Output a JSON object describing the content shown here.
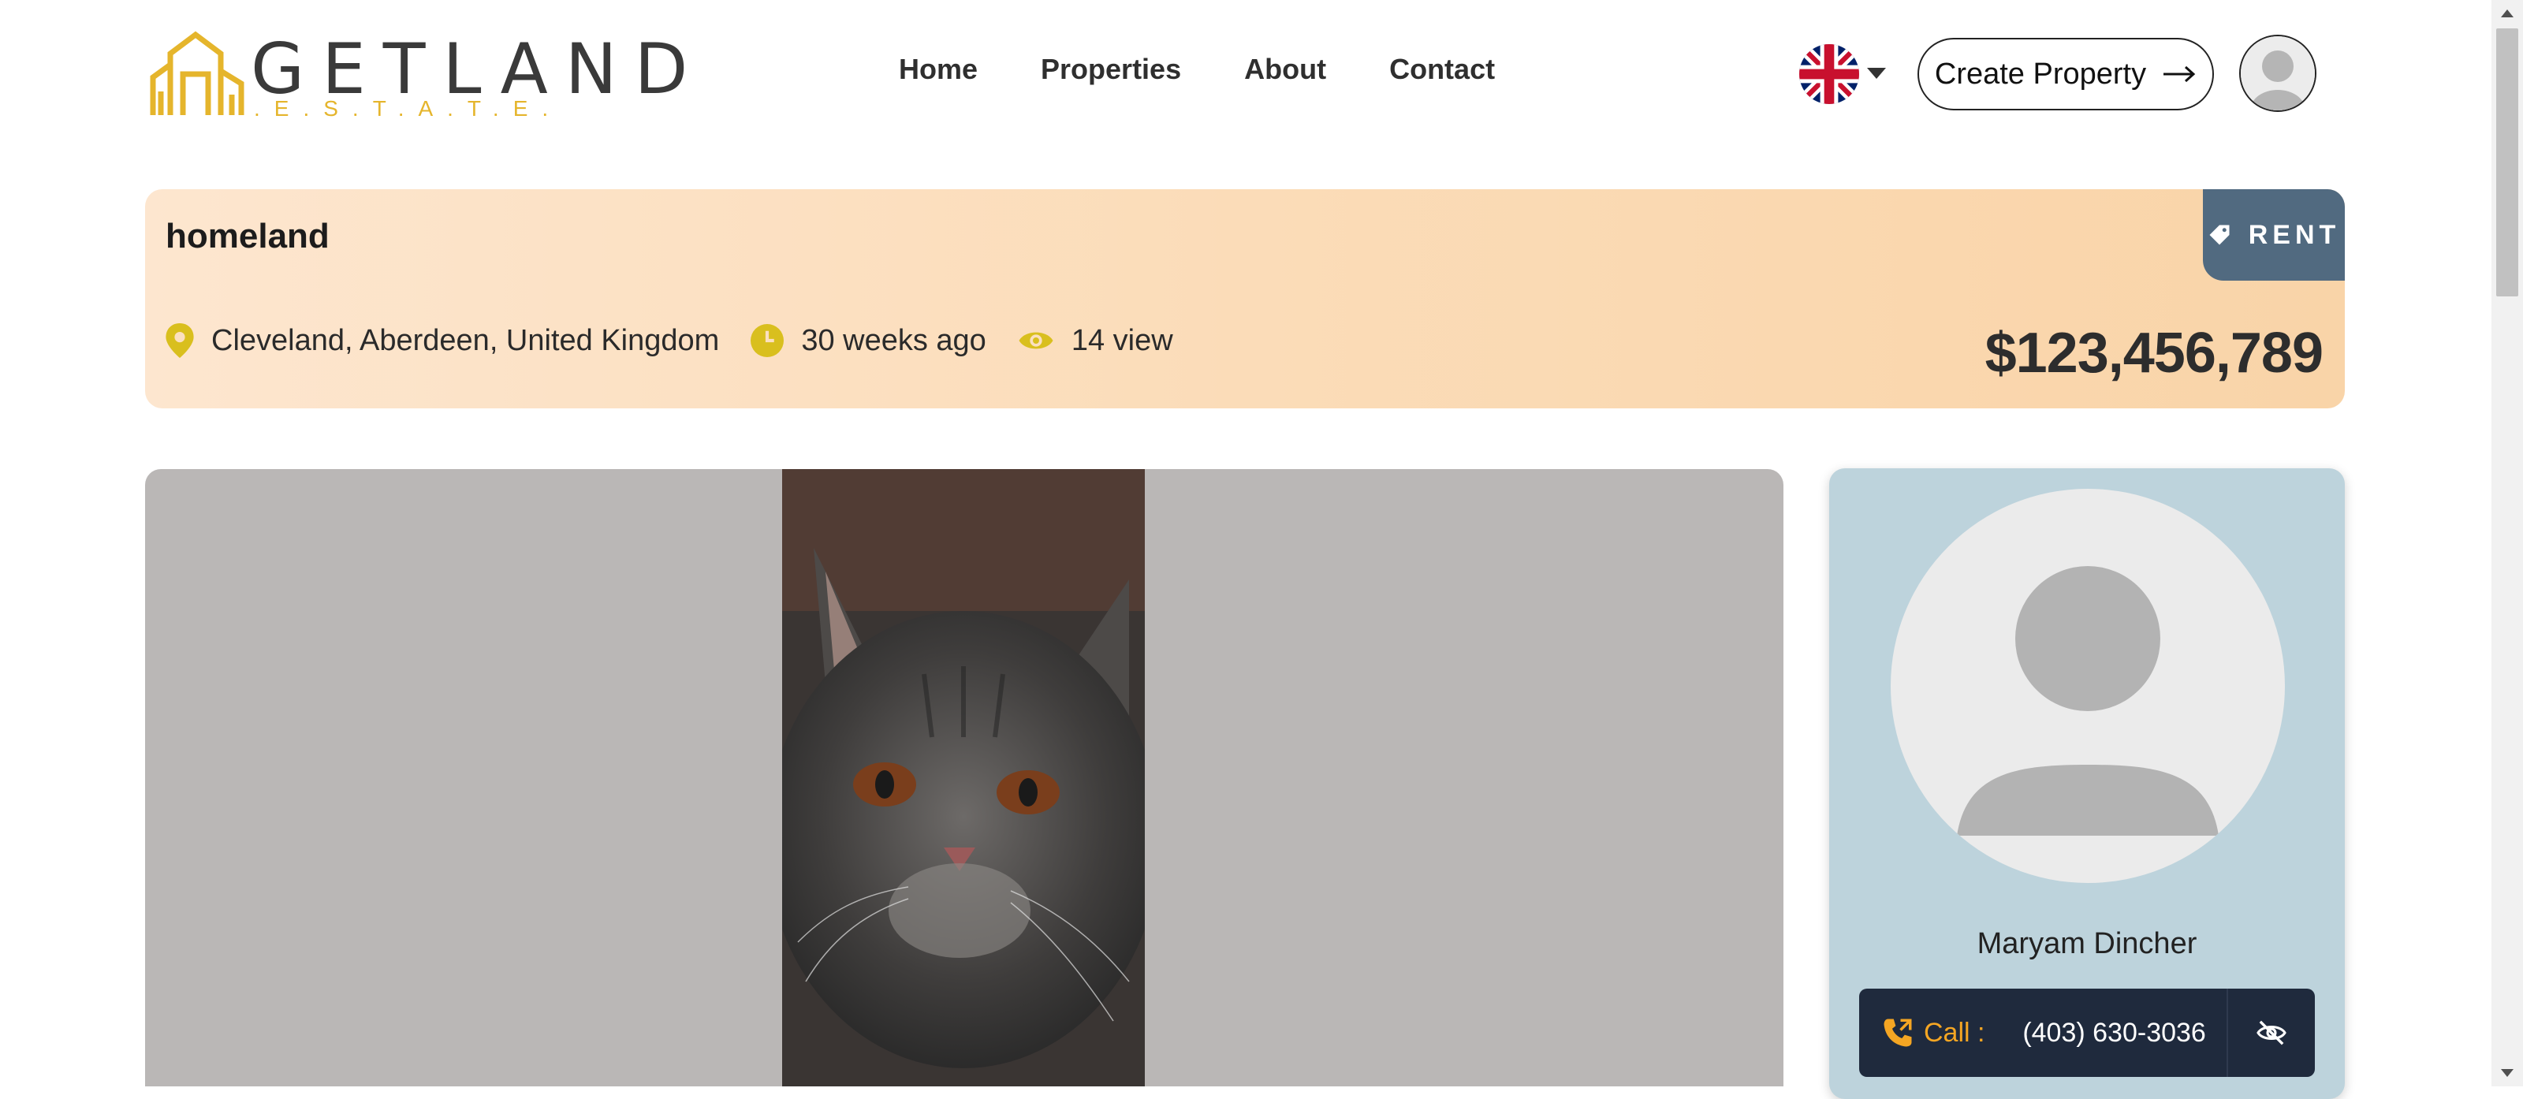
{
  "header": {
    "logo": {
      "word": "GETLAND",
      "sub": ".E.S.T.A.T.E."
    },
    "nav": [
      "Home",
      "Properties",
      "About",
      "Contact"
    ],
    "language_icon": "uk-flag-icon",
    "create_button": "Create Property"
  },
  "listing": {
    "title": "homeland",
    "tag": "RENT",
    "location": "Cleveland, Aberdeen, United Kingdom",
    "posted": "30 weeks ago",
    "views": "14 view",
    "price": "$123,456,789"
  },
  "agent": {
    "name": "Maryam Dincher",
    "call_label": "Call :",
    "phone": "(403) 630-3036"
  },
  "colors": {
    "accent_gold": "#e5b52c",
    "tag_bg": "#516a80",
    "agent_card_bg": "#bdd3dc",
    "call_bar_bg": "#1f2a3d",
    "call_label": "#f5a623"
  }
}
